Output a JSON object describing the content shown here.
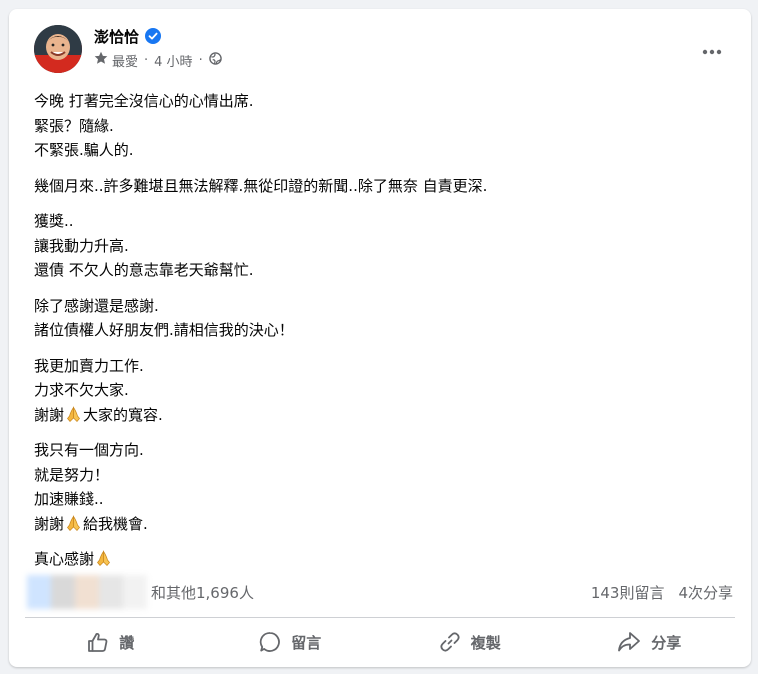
{
  "post": {
    "author_name": "澎恰恰",
    "audience": "最愛",
    "dot": "·",
    "time": "4 小時",
    "paragraphs": [
      [
        "今晚 打著完全沒信心的心情出席.",
        "緊張？隨緣.",
        "不緊張.騙人的."
      ],
      [
        "幾個月來..許多難堪且無法解釋.無從印證的新聞..除了無奈 自責更深."
      ],
      [
        "獲獎..",
        "讓我動力升高.",
        "還債 不欠人的意志靠老天爺幫忙."
      ],
      [
        "除了感謝還是感謝.",
        "諸位債權人好朋友們.請相信我的決心！"
      ],
      [
        "我更加賣力工作.",
        "力求不欠大家."
      ],
      [
        "我只有一個方向.",
        "就是努力！",
        "加速賺錢.."
      ]
    ],
    "p5_line3_a": "謝謝",
    "p5_line3_b": "大家的寬容.",
    "p6_line4_a": "謝謝",
    "p6_line4_b": "給我機會.",
    "last_line": "真心感謝",
    "icons": {
      "verified": "verified-badge-icon",
      "audience": "star-icon",
      "privacy": "globe-icon",
      "more": "more-dots-icon",
      "emoji": "folded-hands-emoji"
    }
  },
  "stats": {
    "reactions_text": "和其他1,696人",
    "comments": "143則留言",
    "shares": "4次分享"
  },
  "actions": {
    "like": "讚",
    "comment": "留言",
    "copy": "複製",
    "share": "分享"
  },
  "colors": {
    "accent": "#1877f2",
    "secondary_text": "#65676b",
    "background": "#f0f2f5"
  }
}
